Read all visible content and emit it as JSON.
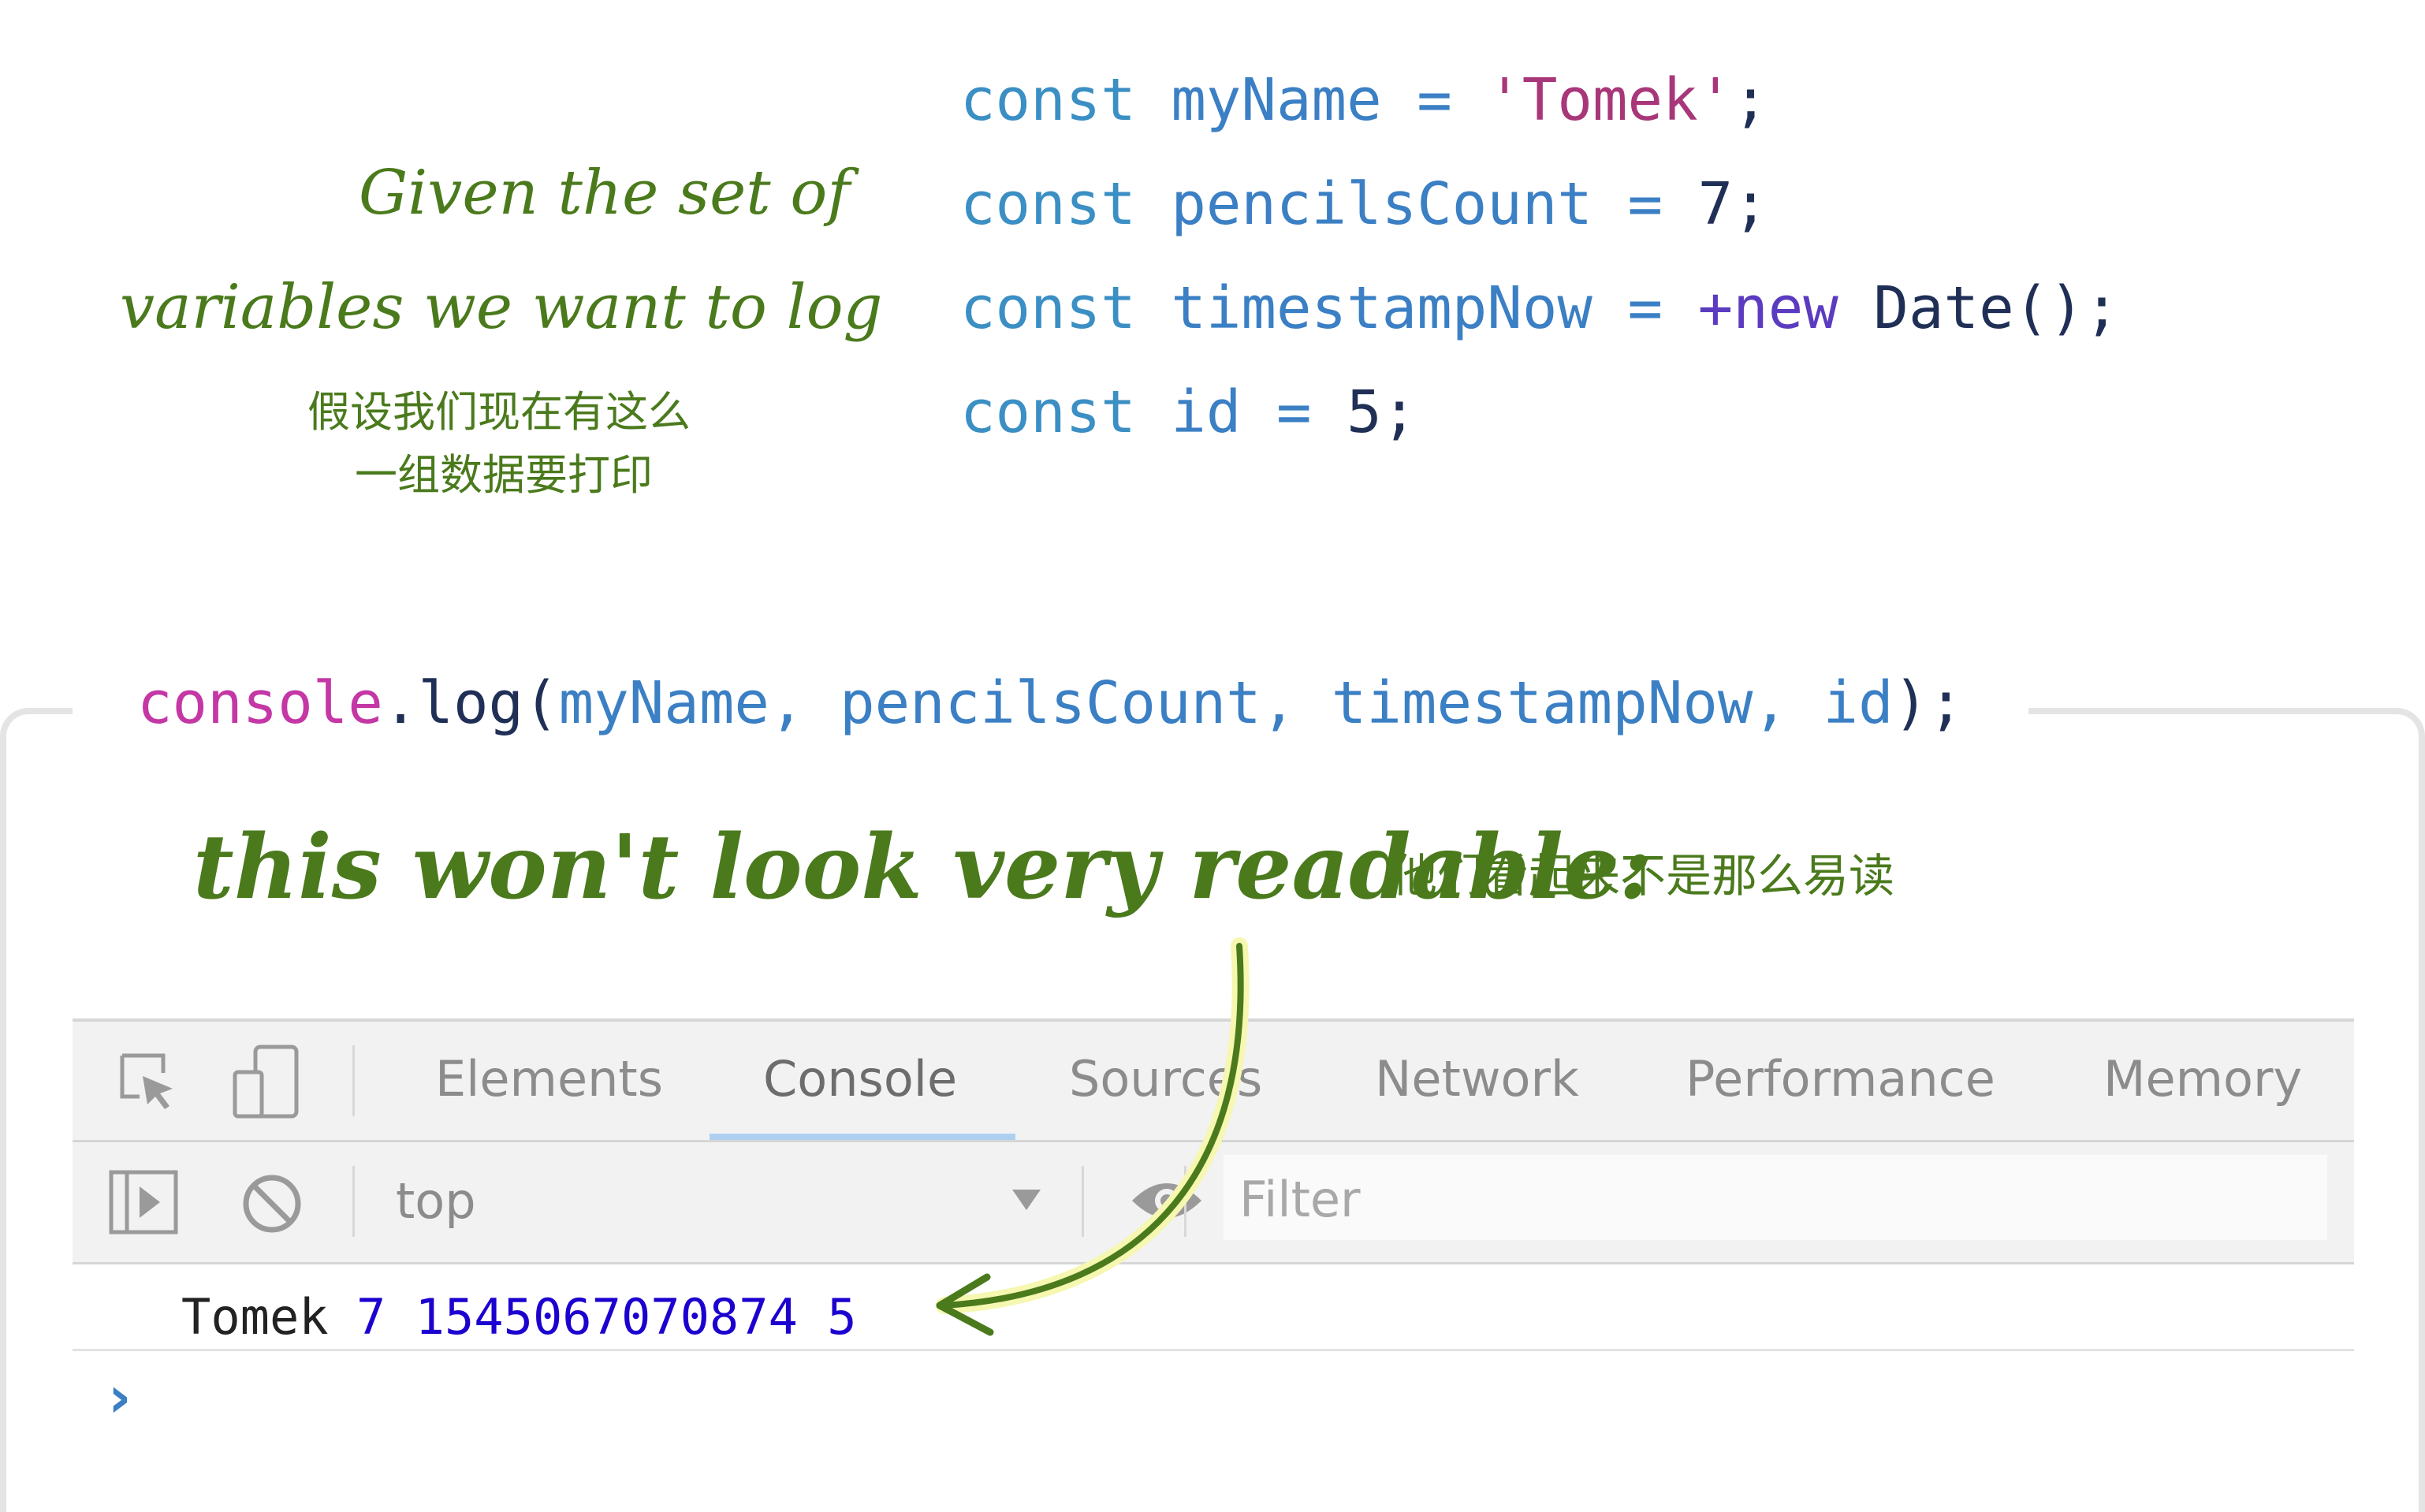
{
  "annotations": {
    "top_left_line1": "Given the set of",
    "top_left_line2": "variables we want to log",
    "top_left_zh_line1": "假设我们现在有这么",
    "top_left_zh_line2": "一组数据要打印",
    "middle": "this won't look very readable:",
    "middle_zh": "他们看起来不是那么易读"
  },
  "code": {
    "line1": {
      "kw": "const",
      "name": "myName",
      "op": "=",
      "value": "'Tomek'",
      "end": ";"
    },
    "line2": {
      "kw": "const",
      "name": "pencilsCount",
      "op": "=",
      "value": "7",
      "end": ";"
    },
    "line3": {
      "kw": "const",
      "name": "timestampNow",
      "op": "=",
      "new": "+new",
      "value": "Date()",
      "end": ";"
    },
    "line4": {
      "kw": "const",
      "name": "id",
      "op": "=",
      "value": "5",
      "end": ";"
    },
    "console_call": {
      "obj": "console",
      "dot": ".",
      "method": "log",
      "open": "(",
      "args": "myName, pencilsCount, timestampNow, id",
      "close": ");"
    }
  },
  "devtools": {
    "tabs": [
      "Elements",
      "Console",
      "Sources",
      "Network",
      "Performance",
      "Memory"
    ],
    "active_tab": "Console",
    "context": "top",
    "filter_placeholder": "Filter",
    "output": {
      "name": "Tomek",
      "values": "7 1545067070874 5"
    },
    "prompt": "›"
  },
  "colors": {
    "annotation_green": "#4a7a1c",
    "tab_active_underline": "#aed0f0",
    "output_number": "#1c00cf",
    "prompt_blue": "#3b7fc4"
  },
  "icons": [
    "inspect-element-icon",
    "device-toolbar-icon",
    "sidebar-toggle-icon",
    "clear-console-icon",
    "dropdown-arrow-icon",
    "eye-icon",
    "curved-arrow-icon"
  ]
}
